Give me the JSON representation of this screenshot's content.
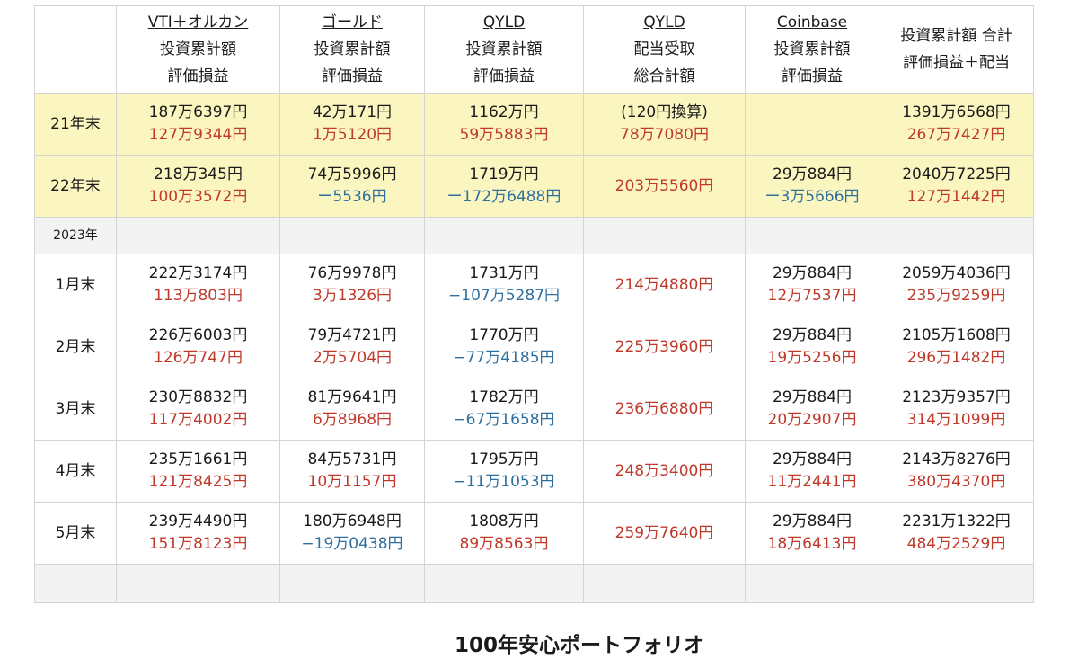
{
  "page_title": "100年安心ポートフォリオ",
  "colors": {
    "profit": "#c0392b",
    "loss": "#2e6f9e",
    "year_row_bg": "#fbf6bf",
    "section_bg": "#f3f3f3"
  },
  "header": {
    "corner": "",
    "columns": [
      {
        "name": "VTI＋オルカン",
        "line2": "投資累計額",
        "line3": "評価損益",
        "underline": true
      },
      {
        "name": "ゴールド",
        "line2": "投資累計額",
        "line3": "評価損益",
        "underline": true
      },
      {
        "name": "QYLD",
        "line2": "投資累計額",
        "line3": "評価損益",
        "underline": true
      },
      {
        "name": "QYLD",
        "line2": "配当受取",
        "line3": "総合計額",
        "underline": true
      },
      {
        "name": "Coinbase",
        "line2": "投資累計額",
        "line3": "評価損益",
        "underline": true
      },
      {
        "name": "投資累計額 合計",
        "line2": "評価損益＋配当",
        "line3": "",
        "underline": false
      }
    ]
  },
  "rows": [
    {
      "label": "21年末",
      "kind": "year",
      "cells": [
        [
          {
            "t": "187万6397円",
            "c": "black"
          },
          {
            "t": "127万9344円",
            "c": "red"
          }
        ],
        [
          {
            "t": "42万171円",
            "c": "black"
          },
          {
            "t": "1万5120円",
            "c": "red"
          }
        ],
        [
          {
            "t": "1162万円",
            "c": "black"
          },
          {
            "t": "59万5883円",
            "c": "red"
          }
        ],
        [
          {
            "t": "(120円換算)",
            "c": "black"
          },
          {
            "t": "78万7080円",
            "c": "red"
          }
        ],
        [],
        [
          {
            "t": "1391万6568円",
            "c": "black"
          },
          {
            "t": "267万7427円",
            "c": "red"
          }
        ]
      ]
    },
    {
      "label": "22年末",
      "kind": "year",
      "cells": [
        [
          {
            "t": "218万345円",
            "c": "black"
          },
          {
            "t": "100万3572円",
            "c": "red"
          }
        ],
        [
          {
            "t": "74万5996円",
            "c": "black"
          },
          {
            "t": "ー5536円",
            "c": "blue"
          }
        ],
        [
          {
            "t": "1719万円",
            "c": "black"
          },
          {
            "t": "ー172万6488円",
            "c": "blue"
          }
        ],
        [
          {
            "t": "203万5560円",
            "c": "red"
          }
        ],
        [
          {
            "t": "29万884円",
            "c": "black"
          },
          {
            "t": "ー3万5666円",
            "c": "blue"
          }
        ],
        [
          {
            "t": "2040万7225円",
            "c": "black"
          },
          {
            "t": "127万1442円",
            "c": "red"
          }
        ]
      ]
    },
    {
      "label": "2023年",
      "kind": "section",
      "cells": [
        [],
        [],
        [],
        [],
        [],
        []
      ]
    },
    {
      "label": "1月末",
      "kind": "month",
      "cells": [
        [
          {
            "t": "222万3174円",
            "c": "black"
          },
          {
            "t": "113万803円",
            "c": "red"
          }
        ],
        [
          {
            "t": "76万9978円",
            "c": "black"
          },
          {
            "t": "3万1326円",
            "c": "red"
          }
        ],
        [
          {
            "t": "1731万円",
            "c": "black"
          },
          {
            "t": "−107万5287円",
            "c": "blue"
          }
        ],
        [
          {
            "t": "214万4880円",
            "c": "red"
          }
        ],
        [
          {
            "t": "29万884円",
            "c": "black"
          },
          {
            "t": "12万7537円",
            "c": "red"
          }
        ],
        [
          {
            "t": "2059万4036円",
            "c": "black"
          },
          {
            "t": "235万9259円",
            "c": "red"
          }
        ]
      ]
    },
    {
      "label": "2月末",
      "kind": "month",
      "cells": [
        [
          {
            "t": "226万6003円",
            "c": "black"
          },
          {
            "t": "126万747円",
            "c": "red"
          }
        ],
        [
          {
            "t": "79万4721円",
            "c": "black"
          },
          {
            "t": "2万5704円",
            "c": "red"
          }
        ],
        [
          {
            "t": "1770万円",
            "c": "black"
          },
          {
            "t": "−77万4185円",
            "c": "blue"
          }
        ],
        [
          {
            "t": "225万3960円",
            "c": "red"
          }
        ],
        [
          {
            "t": "29万884円",
            "c": "black"
          },
          {
            "t": "19万5256円",
            "c": "red"
          }
        ],
        [
          {
            "t": "2105万1608円",
            "c": "black"
          },
          {
            "t": "296万1482円",
            "c": "red"
          }
        ]
      ]
    },
    {
      "label": "3月末",
      "kind": "month",
      "cells": [
        [
          {
            "t": "230万8832円",
            "c": "black"
          },
          {
            "t": "117万4002円",
            "c": "red"
          }
        ],
        [
          {
            "t": "81万9641円",
            "c": "black"
          },
          {
            "t": "6万8968円",
            "c": "red"
          }
        ],
        [
          {
            "t": "1782万円",
            "c": "black"
          },
          {
            "t": "−67万1658円",
            "c": "blue"
          }
        ],
        [
          {
            "t": "236万6880円",
            "c": "red"
          }
        ],
        [
          {
            "t": "29万884円",
            "c": "black"
          },
          {
            "t": "20万2907円",
            "c": "red"
          }
        ],
        [
          {
            "t": "2123万9357円",
            "c": "black"
          },
          {
            "t": "314万1099円",
            "c": "red"
          }
        ]
      ]
    },
    {
      "label": "4月末",
      "kind": "month",
      "cells": [
        [
          {
            "t": "235万1661円",
            "c": "black"
          },
          {
            "t": "121万8425円",
            "c": "red"
          }
        ],
        [
          {
            "t": "84万5731円",
            "c": "black"
          },
          {
            "t": "10万1157円",
            "c": "red"
          }
        ],
        [
          {
            "t": "1795万円",
            "c": "black"
          },
          {
            "t": "−11万1053円",
            "c": "blue"
          }
        ],
        [
          {
            "t": "248万3400円",
            "c": "red"
          }
        ],
        [
          {
            "t": "29万884円",
            "c": "black"
          },
          {
            "t": "11万2441円",
            "c": "red"
          }
        ],
        [
          {
            "t": "2143万8276円",
            "c": "black"
          },
          {
            "t": "380万4370円",
            "c": "red"
          }
        ]
      ]
    },
    {
      "label": "5月末",
      "kind": "month",
      "cells": [
        [
          {
            "t": "239万4490円",
            "c": "black"
          },
          {
            "t": "151万8123円",
            "c": "red"
          }
        ],
        [
          {
            "t": "180万6948円",
            "c": "black"
          },
          {
            "t": "−19万0438円",
            "c": "blue"
          }
        ],
        [
          {
            "t": "1808万円",
            "c": "black"
          },
          {
            "t": "89万8563円",
            "c": "red"
          }
        ],
        [
          {
            "t": "259万7640円",
            "c": "red"
          }
        ],
        [
          {
            "t": "29万884円",
            "c": "black"
          },
          {
            "t": "18万6413円",
            "c": "red"
          }
        ],
        [
          {
            "t": "2231万1322円",
            "c": "black"
          },
          {
            "t": "484万2529円",
            "c": "red"
          }
        ]
      ]
    },
    {
      "label": "",
      "kind": "empty",
      "cells": [
        [],
        [],
        [],
        [],
        [],
        []
      ]
    }
  ]
}
